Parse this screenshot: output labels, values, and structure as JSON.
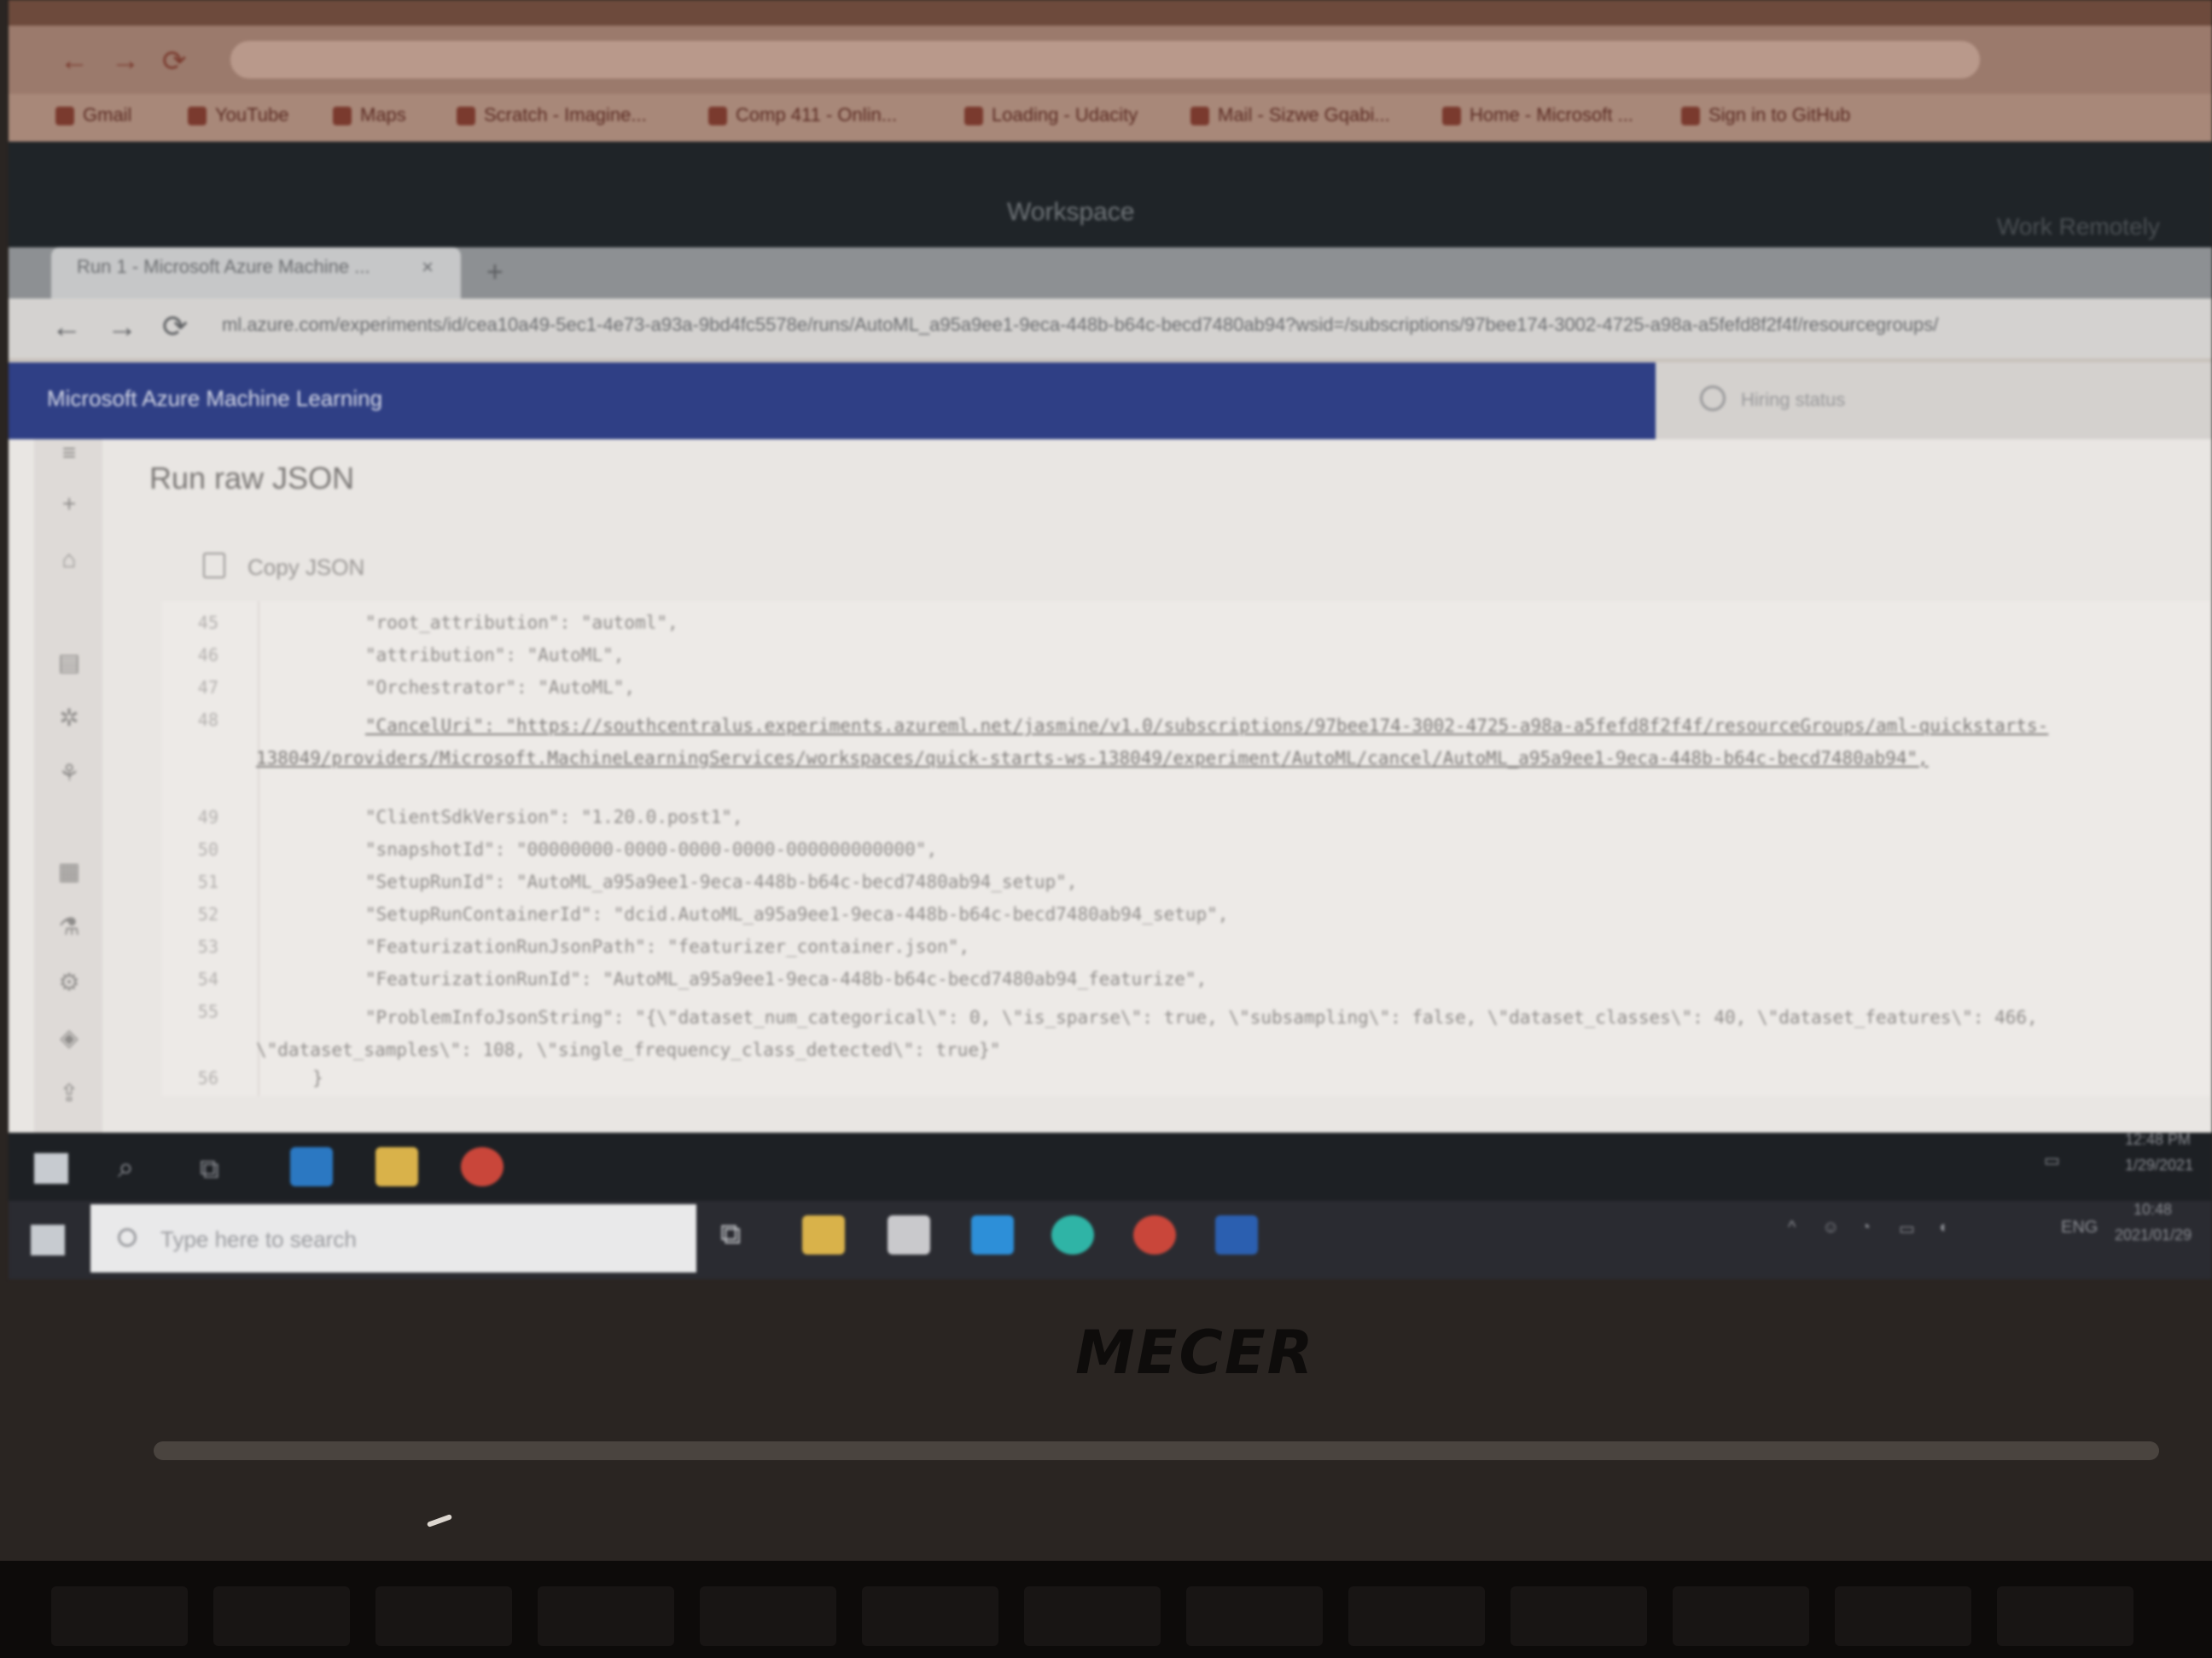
{
  "outer_browser": {
    "bookmarks": [
      "Gmail",
      "YouTube",
      "Maps",
      "Scratch - Imagine...",
      "Comp 411 - Onlin...",
      "Loading - Udacity",
      "Mail - Sizwe Gqabi...",
      "Home - Microsoft ...",
      "Sign in to GitHub"
    ]
  },
  "workspace": {
    "title": "Workspace",
    "right_label": "Work Remotely"
  },
  "inner_browser": {
    "tab_label": "Run 1 - Microsoft Azure Machine ...",
    "close_icon": "×",
    "newtab_icon": "+",
    "address": "ml.azure.com/experiments/id/cea10a49-5ec1-4e73-a93a-9bd4fc5578e/runs/AutoML_a95a9ee1-9eca-448b-b64c-becd7480ab94?wsid=/subscriptions/97bee174-3002-4725-a98a-a5fefd8f2f4f/resourcegroups/"
  },
  "azure_ml": {
    "brand_title": "Microsoft Azure Machine Learning",
    "right_label": "Hiring status",
    "panel_title": "Run raw JSON",
    "copy_json_label": "Copy JSON"
  },
  "code_lines": [
    {
      "ln": "45",
      "text": "\"root_attribution\": \"automl\","
    },
    {
      "ln": "46",
      "text": "\"attribution\": \"AutoML\","
    },
    {
      "ln": "47",
      "text": "\"Orchestrator\": \"AutoML\","
    },
    {
      "ln": "48",
      "text": "\"CancelUri\": \"https://southcentralus.experiments.azureml.net/jasmine/v1.0/subscriptions/97bee174-3002-4725-a98a-a5fefd8f2f4f/resourceGroups/aml-quickstarts-138049/providers/Microsoft.MachineLearningServices/workspaces/quick-starts-ws-138049/experiment/AutoML/cancel/AutoML_a95a9ee1-9eca-448b-b64c-becd7480ab94\","
    },
    {
      "ln": "49",
      "text": "\"ClientSdkVersion\": \"1.20.0.post1\","
    },
    {
      "ln": "50",
      "text": "\"snapshotId\": \"00000000-0000-0000-0000-000000000000\","
    },
    {
      "ln": "51",
      "text": "\"SetupRunId\": \"AutoML_a95a9ee1-9eca-448b-b64c-becd7480ab94_setup\","
    },
    {
      "ln": "52",
      "text": "\"SetupRunContainerId\": \"dcid.AutoML_a95a9ee1-9eca-448b-b64c-becd7480ab94_setup\","
    },
    {
      "ln": "53",
      "text": "\"FeaturizationRunJsonPath\": \"featurizer_container.json\","
    },
    {
      "ln": "54",
      "text": "\"FeaturizationRunId\": \"AutoML_a95a9ee1-9eca-448b-b64c-becd7480ab94_featurize\","
    },
    {
      "ln": "55",
      "text": "\"ProblemInfoJsonString\": \"{\\\"dataset_num_categorical\\\": 0, \\\"is_sparse\\\": true, \\\"subsampling\\\": false, \\\"dataset_classes\\\": 40, \\\"dataset_features\\\": 466, \\\"dataset_samples\\\": 108, \\\"single_frequency_class_detected\\\": true}\""
    },
    {
      "ln": "56",
      "text": "}"
    }
  ],
  "taskbar": {
    "search_placeholder": "Type here to search",
    "remote_time": "12:48 PM",
    "remote_date": "1/29/2021",
    "local_time": "10:48",
    "local_date": "2021/01/29",
    "lang": "ENG"
  },
  "device": {
    "brand": "MECER"
  }
}
